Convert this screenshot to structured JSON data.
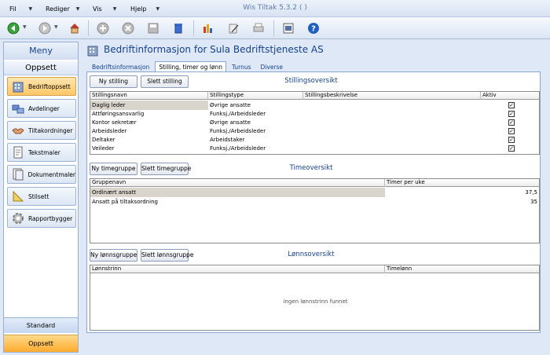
{
  "app": {
    "title": "Wis Tiltak 5.3.2 ( )"
  },
  "menu": [
    "Fil",
    "Rediger",
    "Vis",
    "Hjelp"
  ],
  "toolbar": {
    "icons": [
      "back-icon",
      "forward-icon",
      "home-icon",
      "add-icon",
      "delete-icon",
      "save-icon",
      "trash-icon",
      "chart-icon",
      "edit-icon",
      "print-icon",
      "settings-icon",
      "help-icon"
    ],
    "help_glyph": "?"
  },
  "sidebar": {
    "title": "Meny",
    "section": "Oppsett",
    "items": [
      {
        "label": "Bedriftoppsett",
        "icon": "building-icon",
        "active": true
      },
      {
        "label": "Avdelinger",
        "icon": "departments-icon"
      },
      {
        "label": "Tiltakordninger",
        "icon": "handshake-icon"
      },
      {
        "label": "Tekstmaler",
        "icon": "text-template-icon"
      },
      {
        "label": "Dokumentmaler",
        "icon": "document-template-icon"
      },
      {
        "label": "Stilsett",
        "icon": "ruler-icon"
      },
      {
        "label": "Rapportbygger",
        "icon": "gear-icon"
      }
    ],
    "bottom": [
      "Standard",
      "Oppsett"
    ]
  },
  "page": {
    "title": "Bedriftinformasjon for Sula Bedriftstjeneste AS",
    "tabs": [
      {
        "label": "Bedriftsinformasjon"
      },
      {
        "label": "Stilling, timer og lønn",
        "active": true
      },
      {
        "label": "Turnus"
      },
      {
        "label": "Diverse"
      }
    ]
  },
  "stilling": {
    "new_button": "Ny stilling",
    "delete_button": "Slett stilling",
    "title": "Stillingsoversikt",
    "columns": [
      "Stillingsnavn",
      "Stillingstype",
      "Stillingsbeskrivelse",
      "Aktiv"
    ],
    "rows": [
      {
        "navn": "Daglig leder",
        "type": "Øvrige ansatte",
        "beskrivelse": "",
        "aktiv": true
      },
      {
        "navn": "Attføringsansvarlig",
        "type": "Funksj./Arbeidsleder",
        "beskrivelse": "",
        "aktiv": true
      },
      {
        "navn": "Kontor sekretær",
        "type": "Øvrige ansatte",
        "beskrivelse": "",
        "aktiv": true
      },
      {
        "navn": "Arbeidsleder",
        "type": "Funksj./Arbeidsleder",
        "beskrivelse": "",
        "aktiv": true
      },
      {
        "navn": "Deltaker",
        "type": "Arbeidstaker",
        "beskrivelse": "",
        "aktiv": true
      },
      {
        "navn": "Veileder",
        "type": "Funksj./Arbeidsleder",
        "beskrivelse": "",
        "aktiv": true
      }
    ]
  },
  "timer": {
    "new_button": "Ny timegruppe",
    "delete_button": "Slett timegruppe",
    "title": "Timeoversikt",
    "columns": [
      "Gruppenavn",
      "Timer per uke"
    ],
    "rows": [
      {
        "navn": "Ordinært ansatt",
        "timer": "37,5"
      },
      {
        "navn": "Ansatt på tiltaksordning",
        "timer": "35"
      }
    ]
  },
  "lonn": {
    "new_button": "Ny lønnsgruppe",
    "delete_button": "Slett lønnsgruppe",
    "title": "Lønnsoversikt",
    "columns": [
      "Lønnstrinn",
      "Timelønn"
    ],
    "empty": "ingen lønnstrinn funnet"
  },
  "colors": {
    "accent": "#15428b",
    "active_nav": "#ffc766",
    "background": "#dfe8f6"
  }
}
